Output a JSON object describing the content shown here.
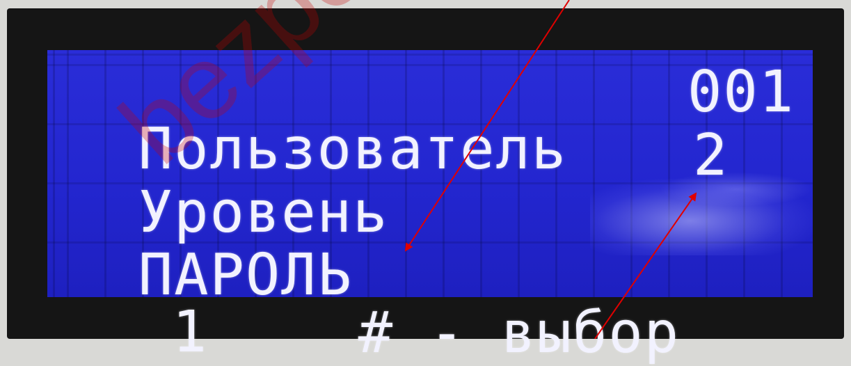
{
  "display": {
    "rows": [
      {
        "label": "Пользователь",
        "value": "001"
      },
      {
        "label": "Уровень",
        "value": "2"
      },
      {
        "label": "ПАРОЛЬ",
        "value": "1"
      },
      {
        "label": "# - выбор"
      }
    ]
  },
  "watermark": {
    "text": "bezpeka"
  },
  "colors": {
    "lcd_background": "#2326cf",
    "lcd_text": "#f2f2ff",
    "annotation_arrow": "#e00000"
  }
}
